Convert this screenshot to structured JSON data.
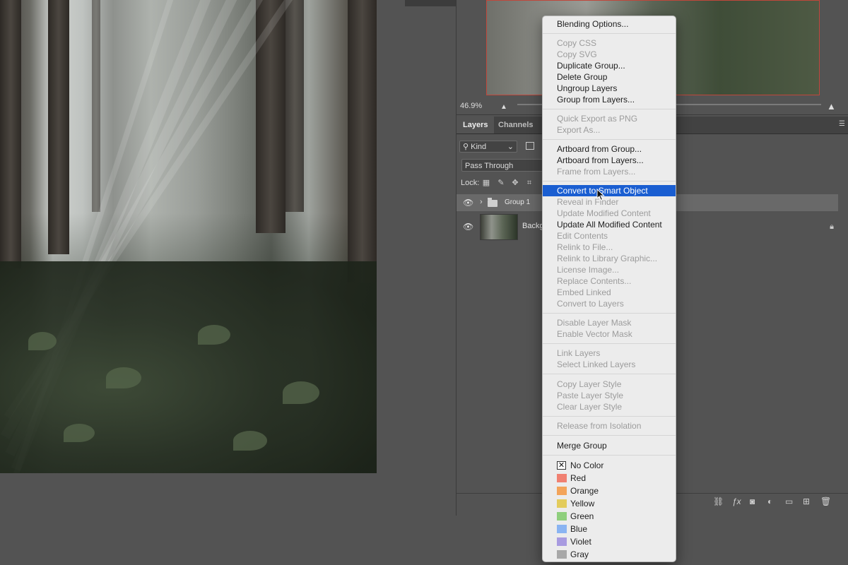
{
  "navigator": {
    "zoom": "46.9%"
  },
  "layers_panel": {
    "tabs": [
      {
        "label": "Layers"
      },
      {
        "label": "Channels"
      }
    ],
    "filter": {
      "kind": "Kind"
    },
    "blend_mode": "Pass Through",
    "lock_label": "Lock:",
    "layers": [
      {
        "name": "Group 1",
        "type": "group",
        "visible": true,
        "selected": true
      },
      {
        "name": "Backg",
        "type": "image",
        "visible": true,
        "locked": true
      }
    ]
  },
  "context_menu": {
    "items": [
      {
        "label": "Blending Options...",
        "enabled": true
      },
      {
        "label": "Copy CSS",
        "enabled": false
      },
      {
        "label": "Copy SVG",
        "enabled": false
      },
      {
        "label": "Duplicate Group...",
        "enabled": true
      },
      {
        "label": "Delete Group",
        "enabled": true
      },
      {
        "label": "Ungroup Layers",
        "enabled": true
      },
      {
        "label": "Group from Layers...",
        "enabled": true
      },
      {
        "label": "Quick Export as PNG",
        "enabled": false
      },
      {
        "label": "Export As...",
        "enabled": false
      },
      {
        "label": "Artboard from Group...",
        "enabled": true
      },
      {
        "label": "Artboard from Layers...",
        "enabled": true
      },
      {
        "label": "Frame from Layers...",
        "enabled": false
      },
      {
        "label": "Convert to Smart Object",
        "enabled": true,
        "highlighted": true
      },
      {
        "label": "Reveal in Finder",
        "enabled": false
      },
      {
        "label": "Update Modified Content",
        "enabled": false
      },
      {
        "label": "Update All Modified Content",
        "enabled": true
      },
      {
        "label": "Edit Contents",
        "enabled": false
      },
      {
        "label": "Relink to File...",
        "enabled": false
      },
      {
        "label": "Relink to Library Graphic...",
        "enabled": false
      },
      {
        "label": "License Image...",
        "enabled": false
      },
      {
        "label": "Replace Contents...",
        "enabled": false
      },
      {
        "label": "Embed Linked",
        "enabled": false
      },
      {
        "label": "Convert to Layers",
        "enabled": false
      },
      {
        "label": "Disable Layer Mask",
        "enabled": false
      },
      {
        "label": "Enable Vector Mask",
        "enabled": false
      },
      {
        "label": "Link Layers",
        "enabled": false
      },
      {
        "label": "Select Linked Layers",
        "enabled": false
      },
      {
        "label": "Copy Layer Style",
        "enabled": false
      },
      {
        "label": "Paste Layer Style",
        "enabled": false
      },
      {
        "label": "Clear Layer Style",
        "enabled": false
      },
      {
        "label": "Release from Isolation",
        "enabled": false
      },
      {
        "label": "Merge Group",
        "enabled": true
      }
    ],
    "colors": [
      {
        "label": "No Color",
        "color": "#ffffff"
      },
      {
        "label": "Red",
        "color": "#f08071"
      },
      {
        "label": "Orange",
        "color": "#f3a45a"
      },
      {
        "label": "Yellow",
        "color": "#e3cc5c"
      },
      {
        "label": "Green",
        "color": "#8fcf7d"
      },
      {
        "label": "Blue",
        "color": "#8ab4f2"
      },
      {
        "label": "Violet",
        "color": "#a89be0"
      },
      {
        "label": "Gray",
        "color": "#a8a8a8"
      }
    ]
  },
  "colors": {
    "highlight": "#1a5ed1",
    "panel_bg": "#535353",
    "artboard_border": "#c0473b"
  }
}
